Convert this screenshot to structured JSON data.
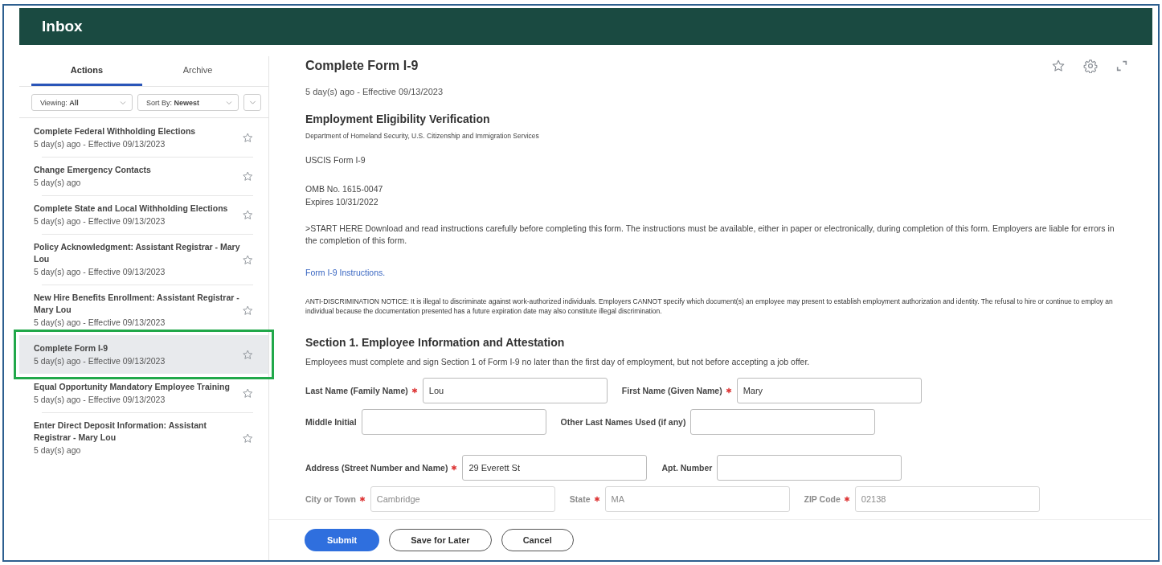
{
  "header": {
    "title": "Inbox"
  },
  "sidebar": {
    "tabs": [
      {
        "label": "Actions",
        "selected": true
      },
      {
        "label": "Archive",
        "selected": false
      }
    ],
    "filters": [
      {
        "label": "Viewing:",
        "value": "All"
      },
      {
        "label": "Sort By:",
        "value": "Newest"
      }
    ],
    "items": [
      {
        "title": "Complete Federal Withholding Elections",
        "subtitle": "5 day(s) ago - Effective 09/13/2023",
        "selected": false
      },
      {
        "title": "Change Emergency Contacts",
        "subtitle": "5 day(s) ago",
        "selected": false
      },
      {
        "title": "Complete State and Local Withholding Elections",
        "subtitle": "5 day(s) ago - Effective 09/13/2023",
        "selected": false
      },
      {
        "title": "Policy Acknowledgment: Assistant Registrar - Mary Lou",
        "subtitle": "5 day(s) ago - Effective 09/13/2023",
        "selected": false
      },
      {
        "title": "New Hire Benefits Enrollment: Assistant Registrar - Mary Lou",
        "subtitle": "5 day(s) ago - Effective 09/13/2023",
        "selected": false
      },
      {
        "title": "Complete Form I-9",
        "subtitle": "5 day(s) ago - Effective 09/13/2023",
        "selected": true
      },
      {
        "title": "Equal Opportunity Mandatory Employee Training",
        "subtitle": "5 day(s) ago - Effective 09/13/2023",
        "selected": false
      },
      {
        "title": "Enter Direct Deposit Information: Assistant Registrar - Mary Lou",
        "subtitle": "5 day(s) ago",
        "selected": false
      }
    ]
  },
  "task": {
    "title": "Complete Form I-9",
    "meta": "5 day(s) ago -  Effective 09/13/2023",
    "blocks": [
      {
        "kind": "heading",
        "text": "Employment Eligibility Verification"
      },
      {
        "kind": "caption",
        "text": "Department of Homeland Security, U.S. Citizenship and Immigration Services"
      },
      {
        "kind": "text",
        "text": "USCIS Form I-9"
      },
      {
        "kind": "lines",
        "lines": [
          "OMB No. 1615-0047",
          "Expires 10/31/2022"
        ]
      },
      {
        "kind": "text",
        "text": ">START HERE Download and read instructions carefully before completing this form. The instructions must be available, either in paper or electronically, during completion of this form. Employers are liable for errors in the completion of this form."
      },
      {
        "kind": "link",
        "text": "Form I-9 Instructions."
      },
      {
        "kind": "notice",
        "text": "ANTI-DISCRIMINATION NOTICE: It is illegal to discriminate against work-authorized individuals. Employers CANNOT specify which document(s) an employee may present to establish employment authorization and identity. The refusal to hire or continue to employ an individual because the documentation presented has a future expiration date may also constitute illegal discrimination."
      },
      {
        "kind": "section",
        "text": "Section 1. Employee Information and Attestation"
      },
      {
        "kind": "text",
        "text": "Employees must complete and sign Section 1 of Form I-9 no later than the first day of employment, but not before accepting a job offer."
      }
    ],
    "field_rows": [
      {
        "fields": [
          {
            "label": "Last Name (Family Name)",
            "required": true,
            "value": "Lou"
          },
          {
            "label": "First Name (Given Name)",
            "required": true,
            "value": "Mary"
          }
        ]
      },
      {
        "fields": [
          {
            "label": "Middle Initial",
            "required": false
          },
          {
            "label": "Other Last Names Used (if any)",
            "required": false
          }
        ]
      },
      {
        "fields": [
          {
            "label": "Address (Street Number and Name)",
            "required": true,
            "value": "29 Everett St"
          },
          {
            "label": "Apt. Number",
            "required": false
          }
        ]
      },
      {
        "fields": [
          {
            "label": "City or Town",
            "required": true,
            "value": "Cambridge"
          },
          {
            "label": "State",
            "required": true,
            "value": "MA"
          },
          {
            "label": "ZIP Code",
            "required": true,
            "value": "02138"
          }
        ]
      }
    ]
  },
  "footer": {
    "buttons": [
      {
        "label": "Submit",
        "kind": "primary"
      },
      {
        "label": "Save for Later",
        "kind": "secondary"
      },
      {
        "label": "Cancel",
        "kind": "secondary"
      }
    ]
  }
}
